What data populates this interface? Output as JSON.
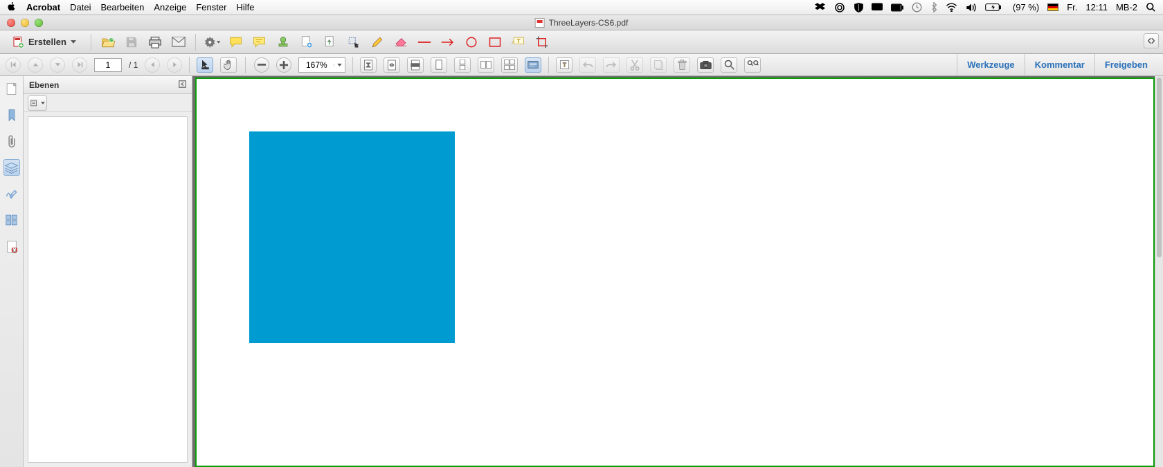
{
  "mac": {
    "app_name": "Acrobat",
    "menus": [
      "Datei",
      "Bearbeiten",
      "Anzeige",
      "Fenster",
      "Hilfe"
    ],
    "battery": "(97 %)",
    "day": "Fr.",
    "time": "12:11",
    "user": "MB-2"
  },
  "window": {
    "filename": "ThreeLayers-CS6.pdf"
  },
  "toolbar": {
    "create_label": "Erstellen"
  },
  "nav": {
    "page_current": "1",
    "page_total": "/  1",
    "zoom": "167%"
  },
  "right_tabs": {
    "tools": "Werkzeuge",
    "comment": "Kommentar",
    "share": "Freigeben"
  },
  "panel": {
    "title": "Ebenen"
  }
}
